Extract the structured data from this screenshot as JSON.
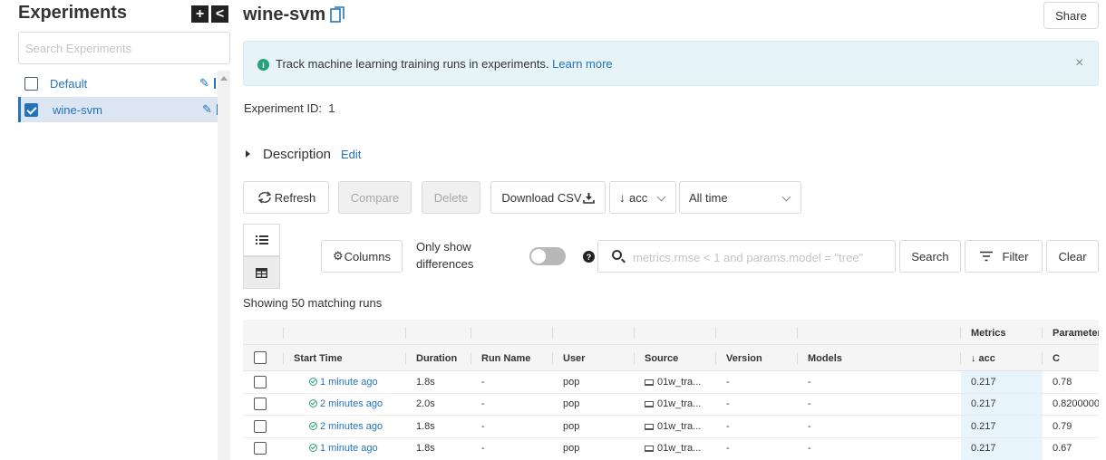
{
  "sidebar": {
    "title": "Experiments",
    "add_icon": "+",
    "collapse_icon": "<",
    "search_placeholder": "Search Experiments",
    "items": [
      {
        "label": "Default",
        "selected": false
      },
      {
        "label": "wine-svm",
        "selected": true
      }
    ]
  },
  "header": {
    "title": "wine-svm",
    "share_label": "Share"
  },
  "banner": {
    "message": "Track machine learning training runs in experiments.",
    "link_text": "Learn more",
    "close_icon": "×"
  },
  "experiment": {
    "id_label": "Experiment ID:",
    "id_value": "1",
    "description_label": "Description",
    "edit_label": "Edit"
  },
  "toolbar": {
    "refresh_label": "Refresh",
    "compare_label": "Compare",
    "delete_label": "Delete",
    "download_label": "Download CSV",
    "sort_label": "acc",
    "time_label": "All time",
    "columns_label": "Columns",
    "only_show_differences_line1": "Only show",
    "only_show_differences_line2": "differences",
    "search_placeholder": "metrics.rmse < 1 and params.model = \"tree\"",
    "search_label": "Search",
    "filter_label": "Filter",
    "clear_label": "Clear"
  },
  "results": {
    "showing_text": "Showing 50 matching runs"
  },
  "table": {
    "group_headers": {
      "metrics": "Metrics",
      "parameters": "Parameter"
    },
    "columns": [
      "Start Time",
      "Duration",
      "Run Name",
      "User",
      "Source",
      "Version",
      "Models",
      "↓ acc",
      "C"
    ],
    "rows": [
      {
        "start_time": "1 minute ago",
        "duration": "1.8s",
        "run_name": "-",
        "user": "pop",
        "source": "01w_tra...",
        "version": "-",
        "models": "-",
        "acc": "0.217",
        "c": "0.78"
      },
      {
        "start_time": "2 minutes ago",
        "duration": "2.0s",
        "run_name": "-",
        "user": "pop",
        "source": "01w_tra...",
        "version": "-",
        "models": "-",
        "acc": "0.217",
        "c": "0.8200000"
      },
      {
        "start_time": "2 minutes ago",
        "duration": "1.8s",
        "run_name": "-",
        "user": "pop",
        "source": "01w_tra...",
        "version": "-",
        "models": "-",
        "acc": "0.217",
        "c": "0.79"
      },
      {
        "start_time": "1 minute ago",
        "duration": "1.8s",
        "run_name": "-",
        "user": "pop",
        "source": "01w_tra...",
        "version": "-",
        "models": "-",
        "acc": "0.217",
        "c": "0.67"
      }
    ]
  },
  "colors": {
    "accent": "#2374bb",
    "banner_bg": "#e6f4f8",
    "success": "#26a17b",
    "selected_bg": "#dbe6f2"
  }
}
